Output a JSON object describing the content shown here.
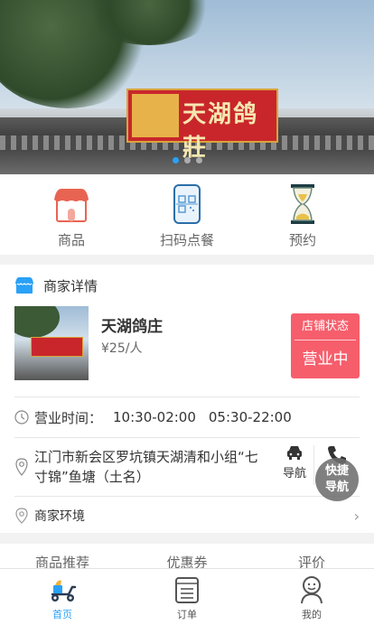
{
  "banner": {
    "sign_text": "天湖鸽莊",
    "slide_count": 3,
    "active_slide": 1
  },
  "quick_menu": [
    {
      "label": "商品",
      "icon": "shop-icon"
    },
    {
      "label": "扫码点餐",
      "icon": "qr-scan-icon"
    },
    {
      "label": "预约",
      "icon": "hourglass-icon"
    }
  ],
  "merchant": {
    "section_title": "商家详情",
    "name": "天湖鸽庄",
    "price": "¥25/人",
    "status_label": "店铺状态",
    "status_value": "营业中",
    "hours_label": "营业时间：",
    "hours": [
      "10:30-02:00",
      "05:30-22:00"
    ],
    "address": "江门市新会区罗坑镇天湖清和小组“七寸锦”鱼塘（土名）",
    "nav_label": "导航",
    "environment_label": "商家环境"
  },
  "fab": {
    "line1": "快捷",
    "line2": "导航"
  },
  "tabs": [
    "商品推荐",
    "优惠券",
    "评价"
  ],
  "bottom_nav": [
    {
      "label": "首页",
      "icon": "home-scooter-icon",
      "active": true
    },
    {
      "label": "订单",
      "icon": "order-list-icon",
      "active": false
    },
    {
      "label": "我的",
      "icon": "profile-icon",
      "active": false
    }
  ],
  "colors": {
    "accent": "#29a1f7",
    "status_red": "#f65e6c"
  }
}
